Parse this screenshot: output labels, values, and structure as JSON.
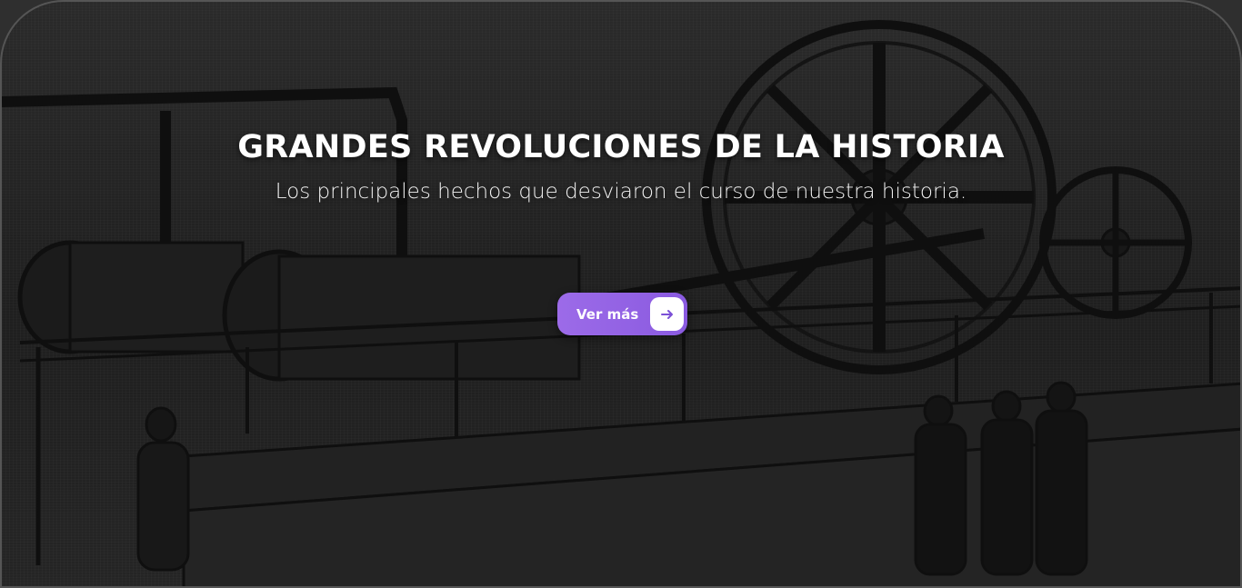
{
  "hero": {
    "title": "GRANDES REVOLUCIONES DE LA HISTORIA",
    "subtitle": "Los principales hechos que desviaron el curso de nuestra historia.",
    "background_image": "engraving-steam-engine-icon",
    "cta": {
      "label": "Ver más",
      "icon": "arrow-right-icon",
      "color": "#9b6ae8",
      "icon_color": "#7b4fd6"
    }
  }
}
